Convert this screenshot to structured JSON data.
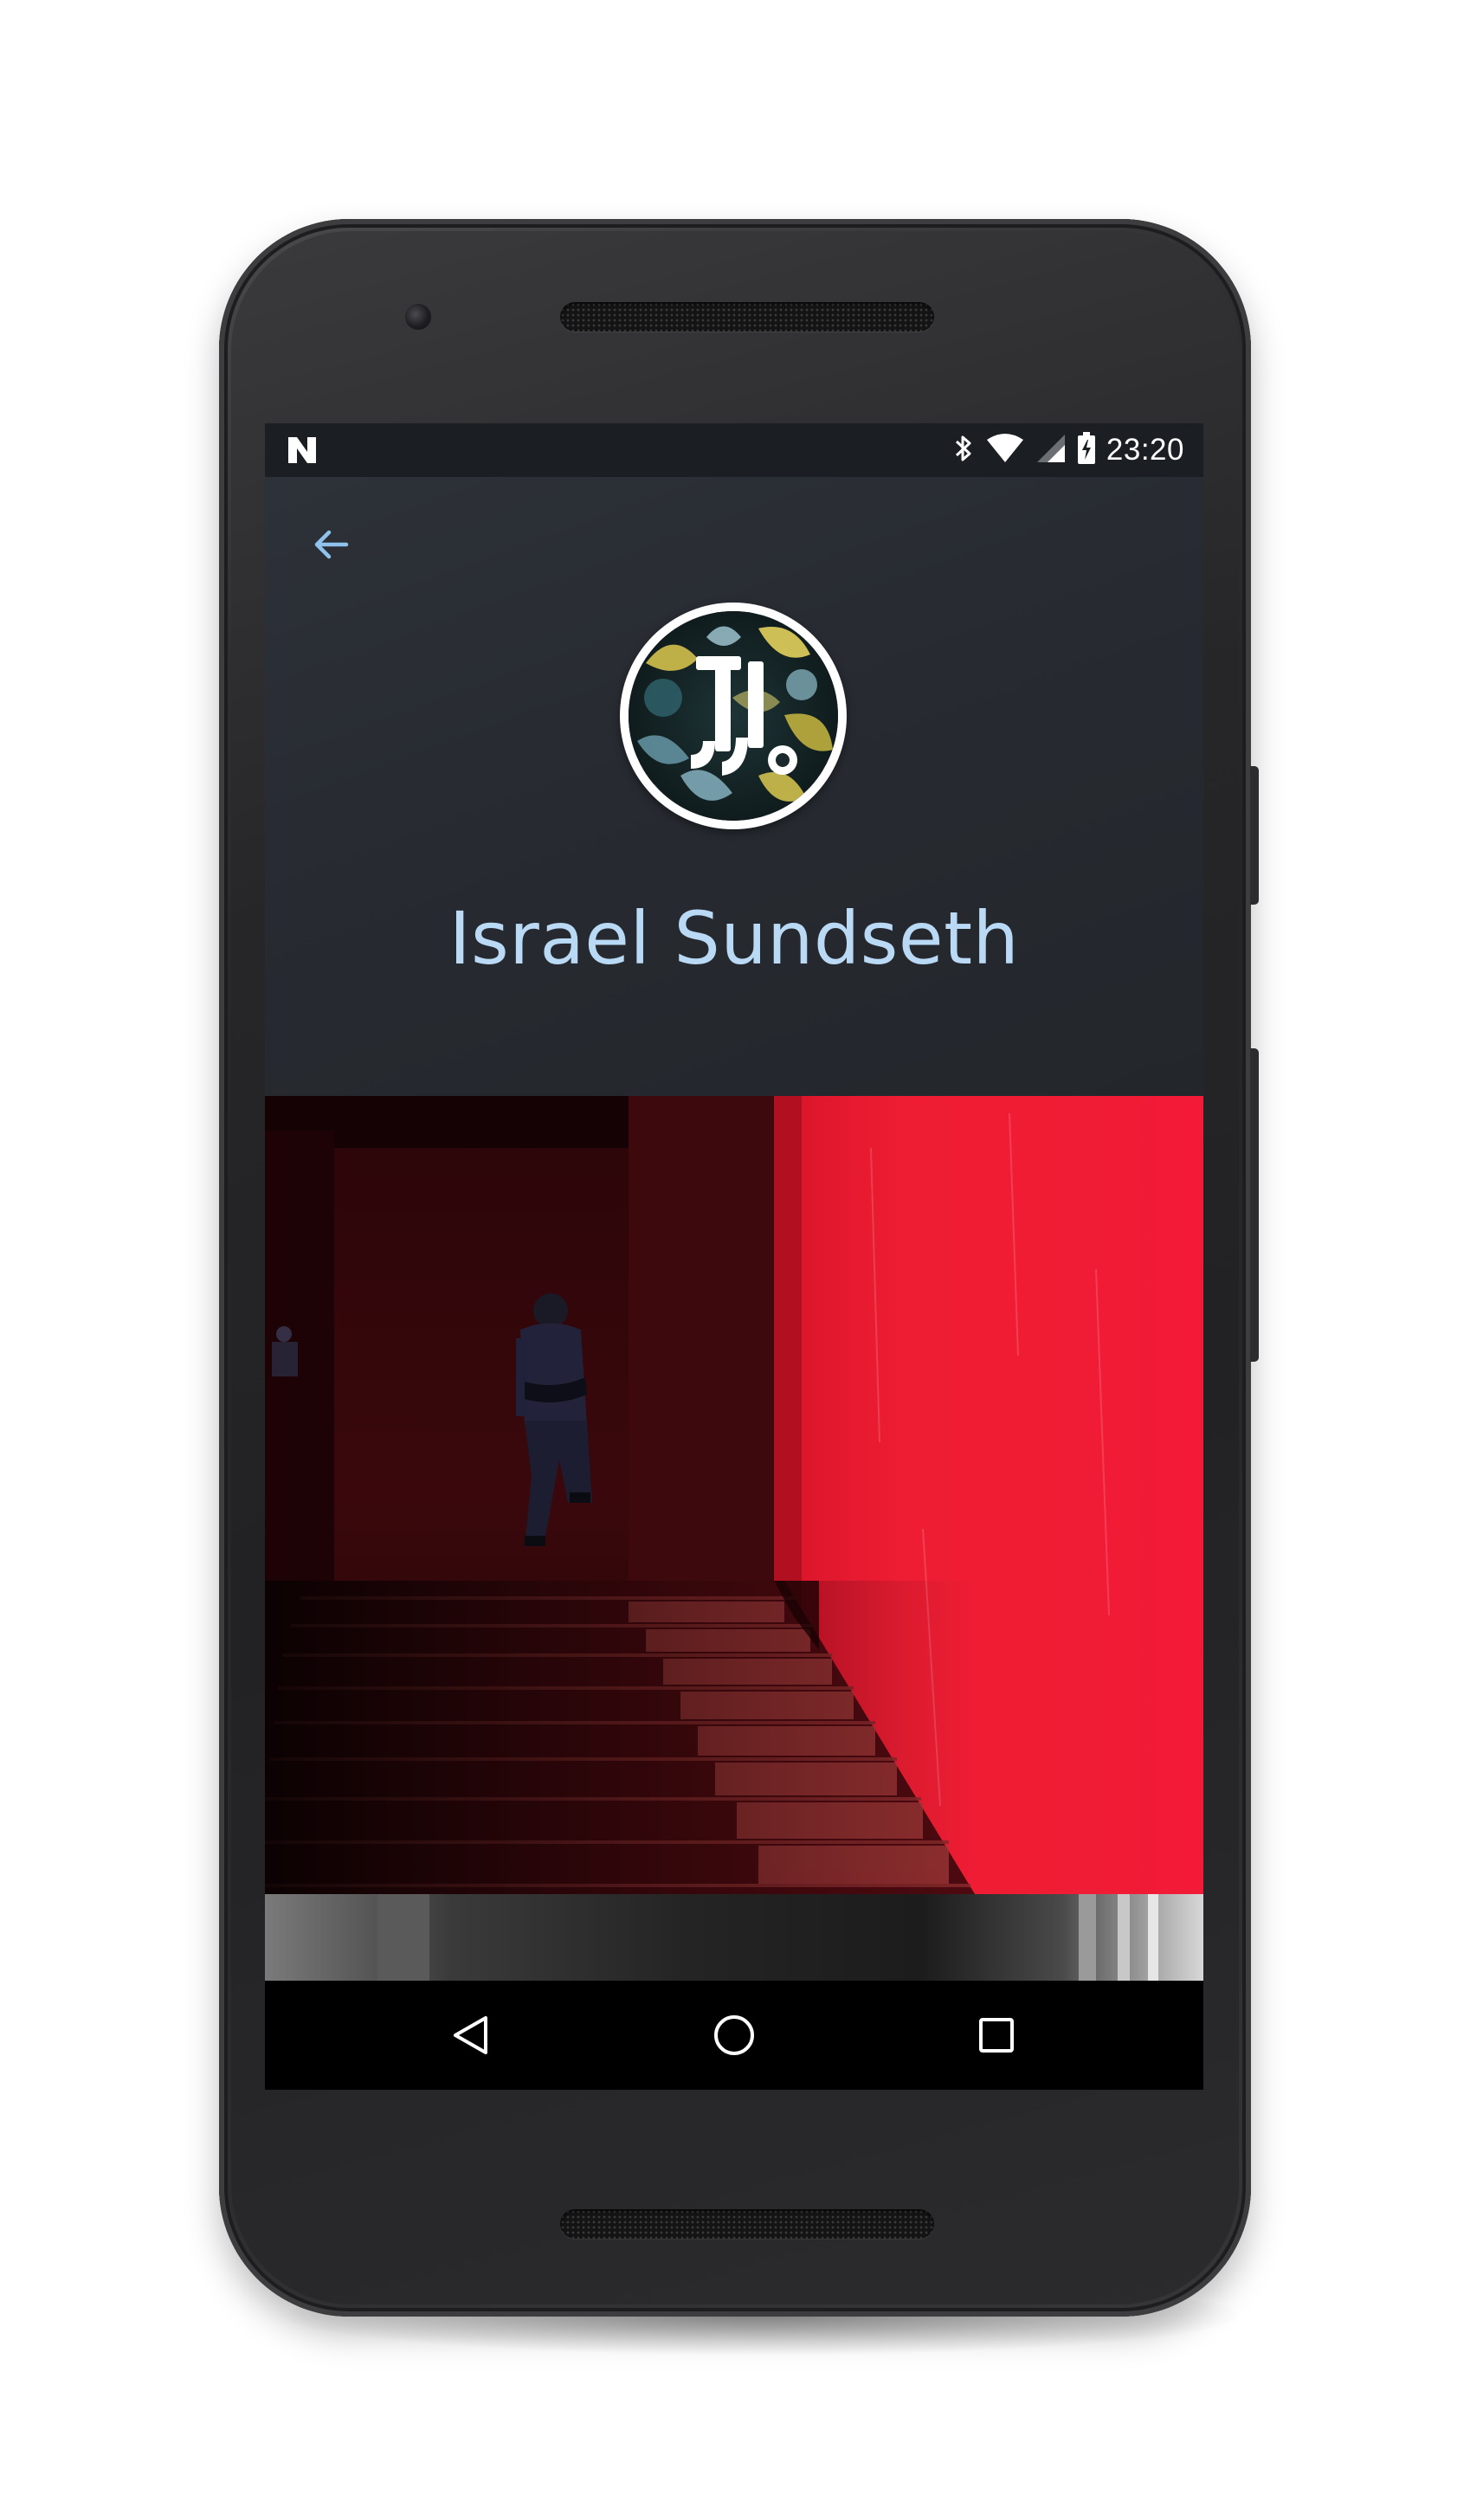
{
  "status_bar": {
    "notification_icon": "n-notification-icon",
    "bluetooth_icon": "bluetooth-icon",
    "wifi_icon": "wifi-icon",
    "signal_icon": "cell-signal-icon",
    "battery_icon": "battery-charging-icon",
    "time": "23:20"
  },
  "toolbar": {
    "back_icon": "arrow-left-icon"
  },
  "profile": {
    "name": "Israel Sundseth",
    "avatar_icon": "profile-avatar"
  },
  "feed": {
    "photo_1": "red-wall-staircase-photo",
    "photo_2": "grayscale-photo-partial"
  },
  "nav_bar": {
    "back_icon": "triangle-back-icon",
    "home_icon": "circle-home-icon",
    "recents_icon": "square-recents-icon"
  },
  "colors": {
    "header_bg": "#272b31",
    "name_text": "#b9d9f5",
    "back_arrow": "#8fc3ee",
    "status_bar_bg": "#1b1e22",
    "nav_bar_bg": "#000000",
    "wall_red": "#e8182e"
  }
}
